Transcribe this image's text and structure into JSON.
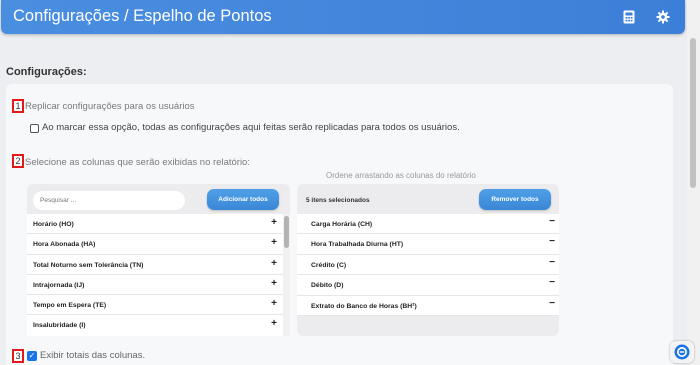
{
  "header": {
    "title": "Configurações / Espelho de Pontos",
    "calculator_icon": "calculator-icon",
    "gear_icon": "gear-icon",
    "color": "#3c7fd8"
  },
  "section_title": "Configurações:",
  "steps": {
    "step1": {
      "number": "1",
      "label": "Replicar configurações para os usuários",
      "checkbox_label": "Ao marcar essa opção, todas as configurações aqui feitas serão replicadas para todos os usuários.",
      "checked": false
    },
    "step2": {
      "number": "2",
      "label": "Selecione as colunas que serão exibidas no relatório:"
    },
    "step3": {
      "number": "3",
      "checkbox_label": "Exibir totais das colunas.",
      "checked": true
    }
  },
  "order_hint": "Ordene arrastando as colunas do relatório",
  "available": {
    "search_placeholder": "Pesquisar ...",
    "add_all_label": "Adicionar todos",
    "items": [
      {
        "label": "Horário (HO)",
        "action": "+"
      },
      {
        "label": "Hora Abonada (HA)",
        "action": "+"
      },
      {
        "label": "Total Noturno sem Tolerância (TN)",
        "action": "+"
      },
      {
        "label": "Intrajornada (IJ)",
        "action": "+"
      },
      {
        "label": "Tempo em Espera (TE)",
        "action": "+"
      },
      {
        "label": "Insalubridade (I)",
        "action": "+"
      }
    ]
  },
  "selected": {
    "count_label": "5 itens selecionados",
    "remove_all_label": "Remover todos",
    "items": [
      {
        "label": "Carga Horária (CH)",
        "action": "−"
      },
      {
        "label": "Hora Trabalhada Diurna (HT)",
        "action": "−"
      },
      {
        "label": "Crédito (C)",
        "action": "−"
      },
      {
        "label": "Débito (D)",
        "action": "−"
      },
      {
        "label": "Extrato do Banco de Horas (BH²)",
        "action": "−"
      }
    ]
  },
  "accent_red": "#e21a1a",
  "button_color": "#3b86d6"
}
